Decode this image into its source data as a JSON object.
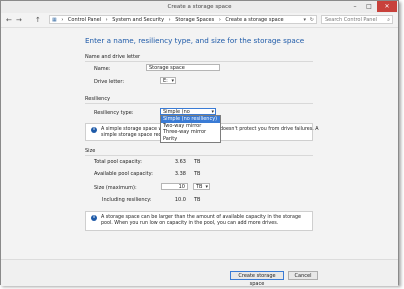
{
  "window": {
    "title": "Create a storage space",
    "min": "–",
    "max": "□",
    "close": "✕"
  },
  "address_bar": {
    "back": "←",
    "forward": "→",
    "up": "↑",
    "root_glyph": "▦",
    "crumbs": [
      "Control Panel",
      "System and Security",
      "Storage Spaces",
      "Create a storage space"
    ],
    "dropdown": "▾",
    "refresh": "↻",
    "search_placeholder": "Search Control Panel",
    "search_icon": "⌕"
  },
  "page": {
    "heading": "Enter a name, resiliency type, and size for the storage space"
  },
  "name_section": {
    "title": "Name and drive letter",
    "name_label": "Name:",
    "name_value": "Storage space",
    "drive_label": "Drive letter:",
    "drive_value": "E:"
  },
  "resiliency": {
    "title": "Resiliency",
    "type_label": "Resiliency type:",
    "type_value": "Simple (no resiliency)",
    "options": [
      "Simple (no resiliency)",
      "Two-way mirror",
      "Three-way mirror",
      "Parity"
    ],
    "selected_index": 0,
    "info_left": "A simple storage space writes",
    "info_right": "doesn't protect you from drive failures. A",
    "info_line2": "simple storage space requires"
  },
  "size": {
    "title": "Size",
    "total_label": "Total pool capacity:",
    "total_value": "3.63",
    "total_unit": "TB",
    "avail_label": "Available pool capacity:",
    "avail_value": "3.38",
    "avail_unit": "TB",
    "max_label": "Size (maximum):",
    "max_value": "10",
    "max_unit": "TB",
    "incl_label": "Including resiliency:",
    "incl_value": "10.0",
    "incl_unit": "TB",
    "info": "A storage space can be larger than the amount of available capacity in the storage pool. When you run low on capacity in the pool, you can add more drives."
  },
  "footer": {
    "create_label": "Create storage space",
    "cancel_label": "Cancel"
  }
}
